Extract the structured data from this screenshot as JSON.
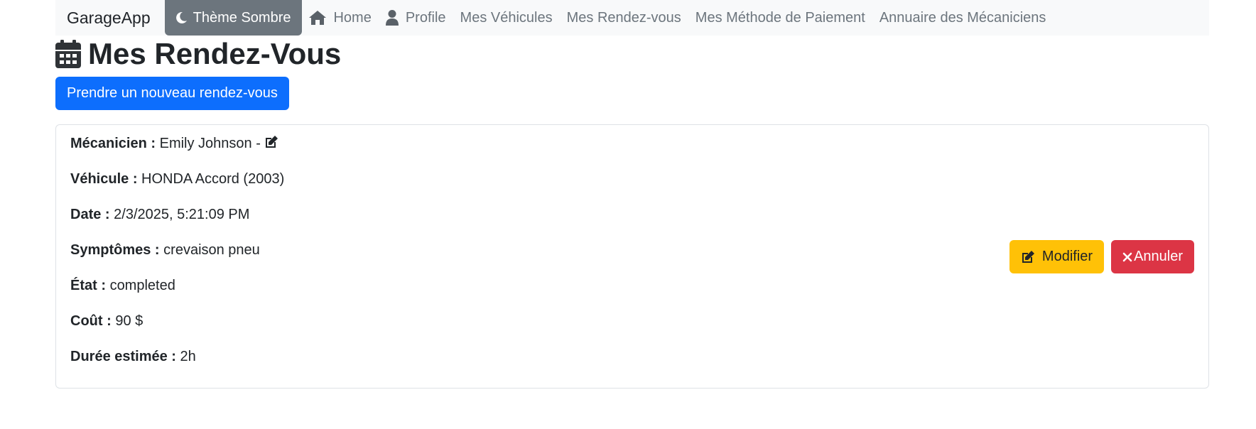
{
  "nav": {
    "brand": "GarageApp",
    "theme_label": "Thème Sombre",
    "links": [
      {
        "label": "Home",
        "icon": "home-icon"
      },
      {
        "label": "Profile",
        "icon": "user-icon"
      },
      {
        "label": "Mes Véhicules"
      },
      {
        "label": "Mes Rendez-vous"
      },
      {
        "label": "Mes Méthode de Paiement"
      },
      {
        "label": "Annuaire des Mécaniciens"
      }
    ]
  },
  "page": {
    "title": "Mes Rendez-Vous",
    "new_button": "Prendre un nouveau rendez-vous"
  },
  "appointment": {
    "mechanic_label": "Mécanicien :",
    "mechanic_value": "Emily Johnson -",
    "vehicle_label": "Véhicule :",
    "vehicle_value": "HONDA Accord (2003)",
    "date_label": "Date :",
    "date_value": "2/3/2025, 5:21:09 PM",
    "symptoms_label": "Symptômes :",
    "symptoms_value": "crevaison pneu",
    "status_label": "État :",
    "status_value": "completed",
    "cost_label": "Coût :",
    "cost_value": "90 $",
    "duration_label": "Durée estimée :",
    "duration_value": "2h",
    "edit_button": "Modifier",
    "cancel_button": "Annuler"
  },
  "colors": {
    "primary": "#0d6efd",
    "warning": "#ffc107",
    "danger": "#dc3545",
    "secondary": "#6c757d"
  }
}
